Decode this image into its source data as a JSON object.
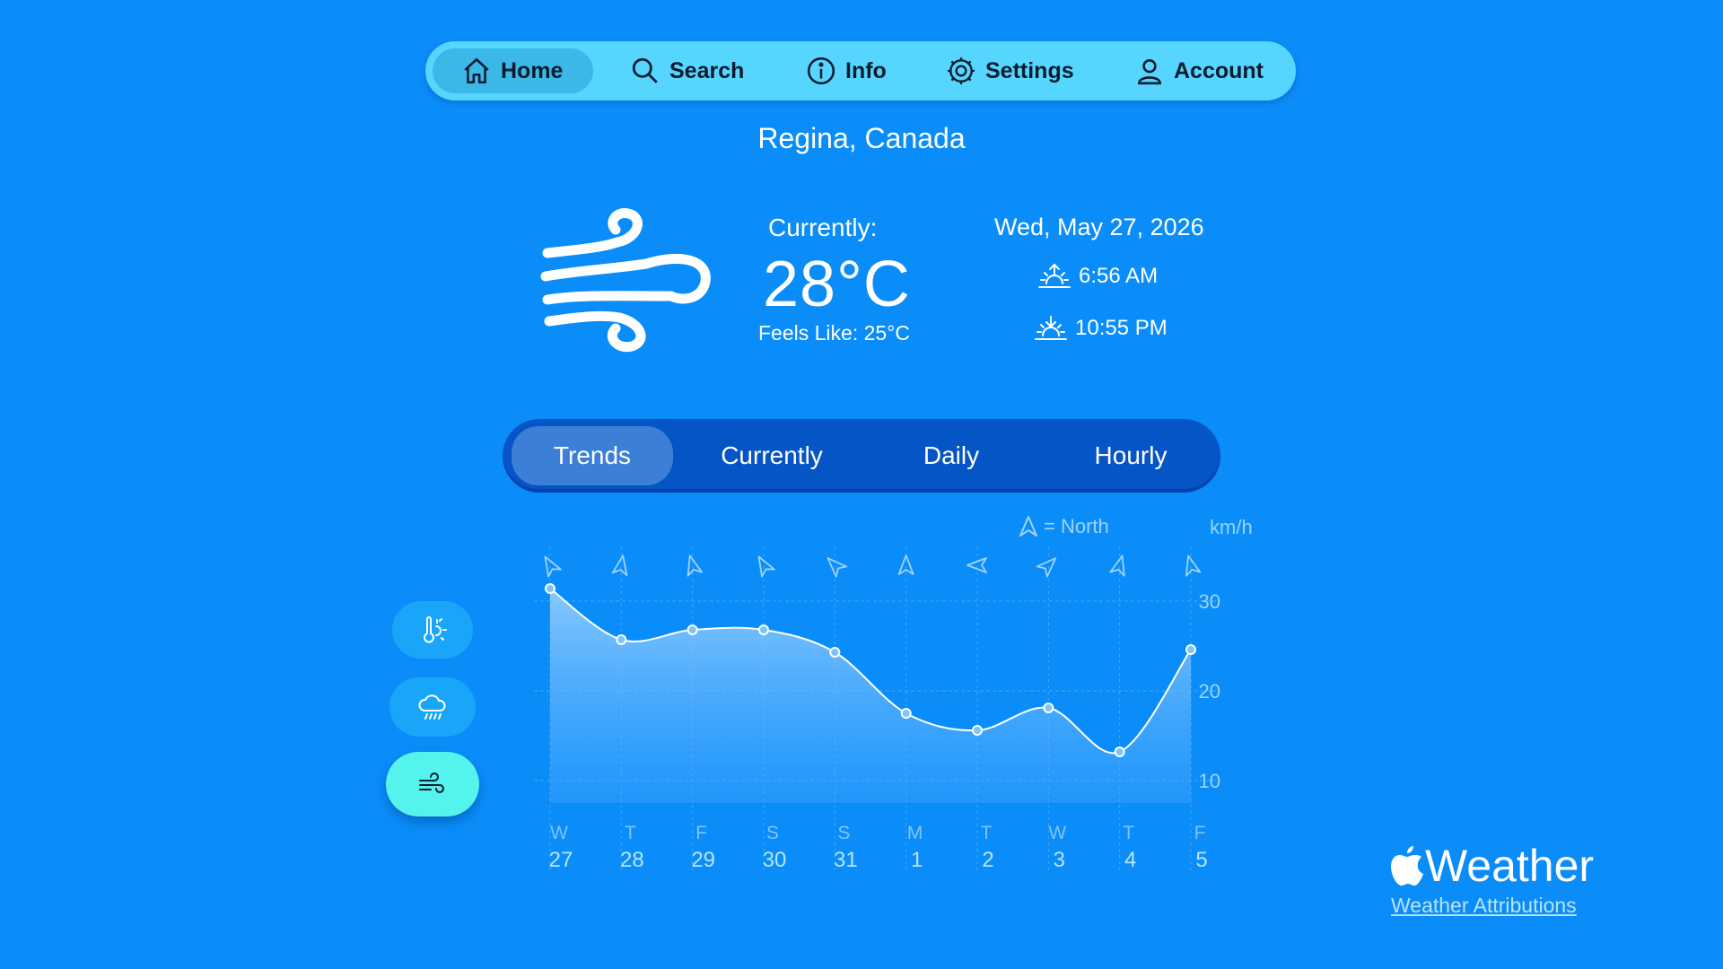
{
  "nav": {
    "items": [
      {
        "label": "Home",
        "icon": "home-icon"
      },
      {
        "label": "Search",
        "icon": "search-icon"
      },
      {
        "label": "Info",
        "icon": "info-icon"
      },
      {
        "label": "Settings",
        "icon": "gear-icon"
      },
      {
        "label": "Account",
        "icon": "person-icon"
      }
    ],
    "active": "Home"
  },
  "location": "Regina, Canada",
  "current": {
    "icon": "wind-icon",
    "label": "Currently:",
    "temperature": "28°C",
    "feels_like": "Feels Like: 25°C"
  },
  "date": "Wed, May 27, 2026",
  "sunrise": "6:56 AM",
  "sunset": "10:55 PM",
  "tabs": [
    "Trends",
    "Currently",
    "Daily",
    "Hourly"
  ],
  "active_tab": "Trends",
  "side_buttons": [
    {
      "icon": "temperature-sun-icon",
      "active": false
    },
    {
      "icon": "cloud-rain-icon",
      "active": false
    },
    {
      "icon": "wind-icon",
      "active": true
    }
  ],
  "legend": {
    "north": "= North",
    "unit": "km/h"
  },
  "chart_data": {
    "type": "area",
    "x_days": [
      "W",
      "T",
      "F",
      "S",
      "S",
      "M",
      "T",
      "W",
      "T",
      "F"
    ],
    "x_dates": [
      "27",
      "28",
      "29",
      "30",
      "31",
      "1",
      "2",
      "3",
      "4",
      "5"
    ],
    "series": [
      {
        "values": [
          31.4,
          25.7,
          26.8,
          26.8,
          24.3,
          17.5,
          15.6,
          18.1,
          13.2,
          24.6
        ]
      }
    ],
    "wind_direction_deg": [
      330,
      10,
      345,
      330,
      315,
      0,
      270,
      45,
      15,
      345
    ],
    "yticks": [
      10,
      20,
      30
    ],
    "ylim": [
      8,
      34
    ],
    "colors": {
      "line": "#ffffff",
      "fill_top": "#9fd3ff",
      "grid": "#4aa6f5"
    }
  },
  "brand": {
    "name": "Weather",
    "attribution": "Weather Attributions"
  }
}
